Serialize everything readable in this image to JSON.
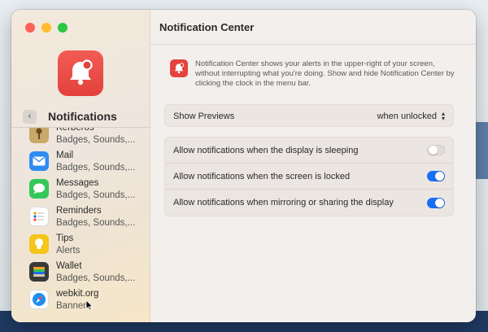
{
  "sidebar": {
    "title": "Notifications",
    "apps": [
      {
        "name": "Kerberos",
        "detail": "Badges, Sounds,...",
        "icon": "kerberos-icon",
        "color": "#c9a86a"
      },
      {
        "name": "Mail",
        "detail": "Badges, Sounds,...",
        "icon": "mail-icon",
        "color": "#2e8cf0"
      },
      {
        "name": "Messages",
        "detail": "Badges, Sounds,...",
        "icon": "messages-icon",
        "color": "#34c759"
      },
      {
        "name": "Reminders",
        "detail": "Badges, Sounds,...",
        "icon": "reminders-icon",
        "color": "#ffffff"
      },
      {
        "name": "Tips",
        "detail": "Alerts",
        "icon": "tips-icon",
        "color": "#f5c518"
      },
      {
        "name": "Wallet",
        "detail": "Badges, Sounds,...",
        "icon": "wallet-icon",
        "color": "#3a3a3a"
      },
      {
        "name": "webkit.org",
        "detail": "Banners",
        "icon": "safari-icon",
        "color": "#1f8ef1"
      }
    ]
  },
  "main": {
    "title": "Notification Center",
    "info": "Notification Center shows your alerts in the upper-right of your screen, without interrupting what you're doing. Show and hide Notification Center by clicking the clock in the menu bar.",
    "previews_label": "Show Previews",
    "previews_value": "when unlocked",
    "toggles": [
      {
        "label": "Allow notifications when the display is sleeping",
        "on": false
      },
      {
        "label": "Allow notifications when the screen is locked",
        "on": true
      },
      {
        "label": "Allow notifications when mirroring or sharing the display",
        "on": true
      }
    ]
  },
  "colors": {
    "accent": "#1a6ef5",
    "alert_red": "#e5443d"
  }
}
